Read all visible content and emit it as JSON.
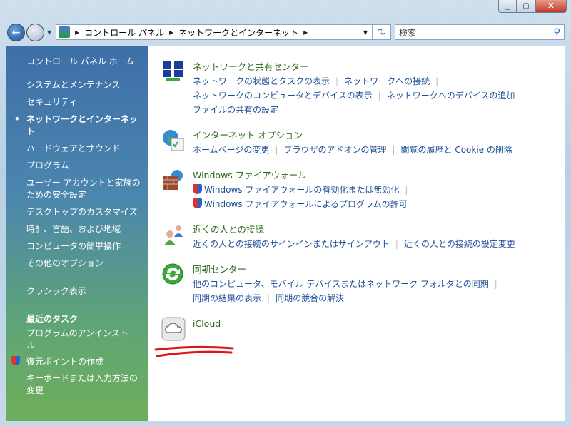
{
  "window": {
    "minimize": "▭",
    "maximize": "▢",
    "close": "X"
  },
  "address_bar": {
    "segments": [
      "コントロール パネル",
      "ネットワークとインターネット"
    ]
  },
  "search": {
    "placeholder": "検索"
  },
  "sidebar": {
    "home": "コントロール パネル ホーム",
    "items": [
      "システムとメンテナンス",
      "セキュリティ",
      "ネットワークとインターネット",
      "ハードウェアとサウンド",
      "プログラム",
      "ユーザー アカウントと家族のための安全設定",
      "デスクトップのカスタマイズ",
      "時計、言語、および地域",
      "コンピュータの簡単操作",
      "その他のオプション"
    ],
    "classic": "クラシック表示",
    "recent_header": "最近のタスク",
    "recent": [
      "プログラムのアンインストール",
      "復元ポイントの作成",
      "キーボードまたは入力方法の変更"
    ]
  },
  "categories": [
    {
      "title": "ネットワークと共有センター",
      "lines": [
        [
          "ネットワークの状態とタスクの表示",
          "ネットワークへの接続"
        ],
        [
          "ネットワークのコンピュータとデバイスの表示",
          "ネットワークへのデバイスの追加"
        ],
        [
          "ファイルの共有の設定"
        ]
      ]
    },
    {
      "title": "インターネット オプション",
      "lines": [
        [
          "ホームページの変更",
          "ブラウザのアドオンの管理",
          "閲覧の履歴と Cookie の削除"
        ]
      ]
    },
    {
      "title": "Windows ファイアウォール",
      "lines": [
        [
          "Windows ファイアウォールの有効化または無効化"
        ],
        [
          "Windows ファイアウォールによるプログラムの許可"
        ]
      ]
    },
    {
      "title": "近くの人との接続",
      "lines": [
        [
          "近くの人との接続のサインインまたはサインアウト",
          "近くの人との接続の設定変更"
        ]
      ]
    },
    {
      "title": "同期センター",
      "lines": [
        [
          "他のコンピュータ、モバイル デバイスまたはネットワーク フォルダとの同期"
        ],
        [
          "同期の結果の表示",
          "同期の競合の解決"
        ]
      ]
    },
    {
      "title": "iCloud",
      "lines": []
    }
  ]
}
